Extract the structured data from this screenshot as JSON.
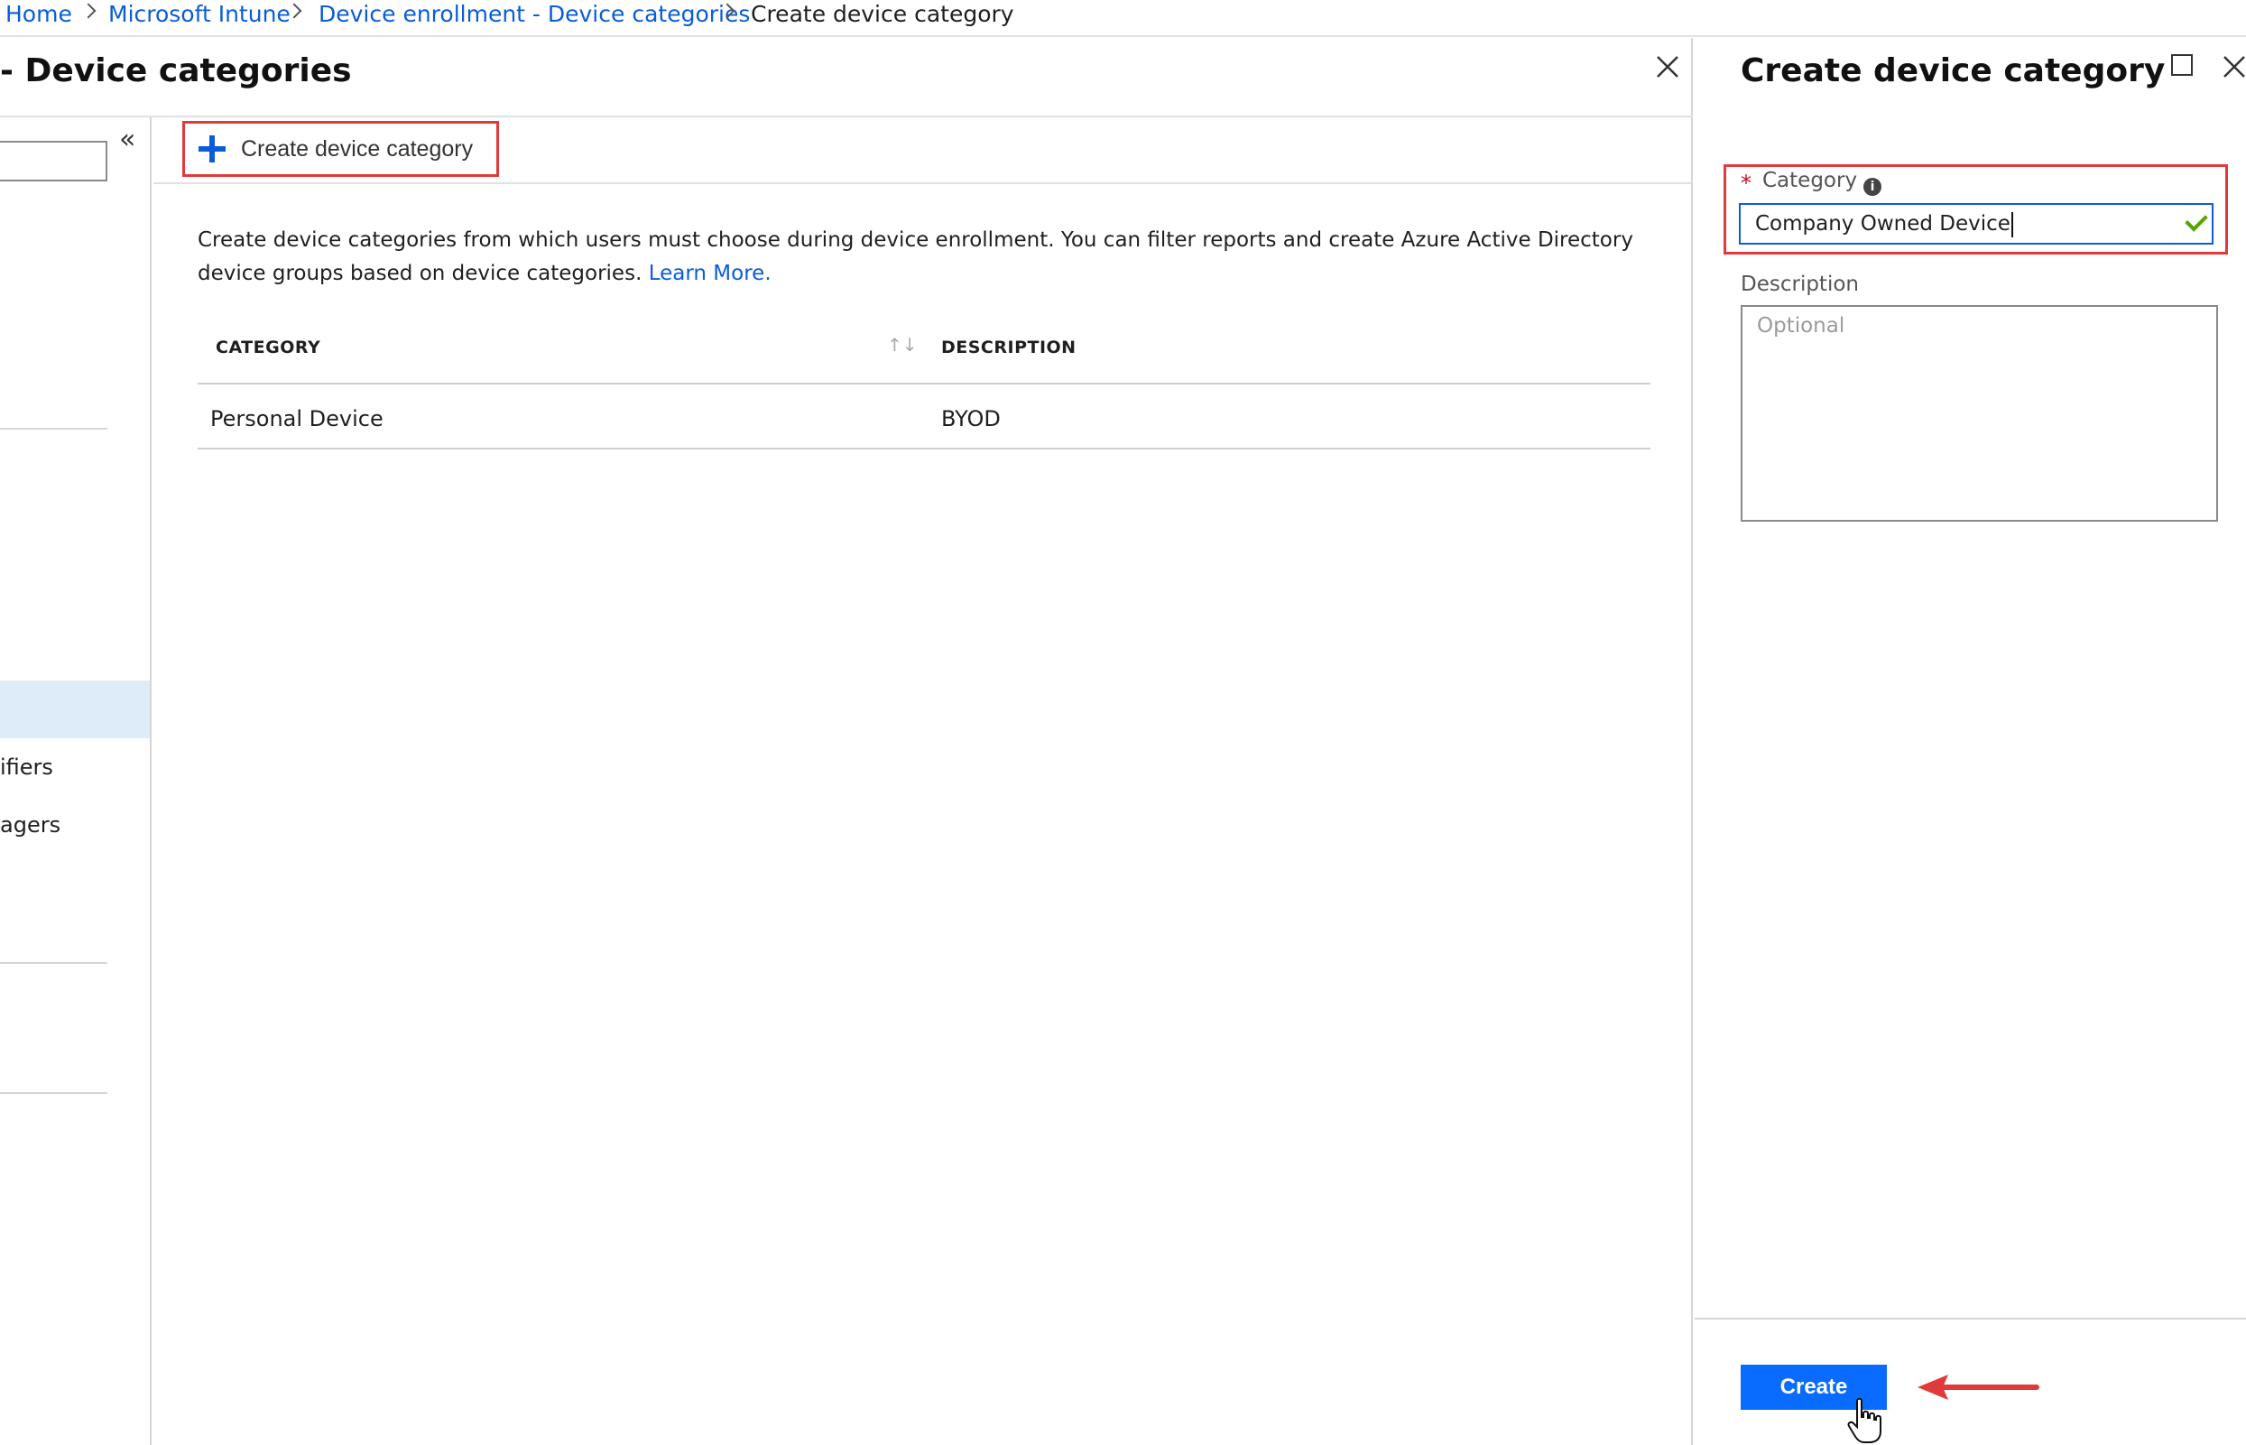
{
  "breadcrumb": {
    "items": [
      {
        "label": "Home"
      },
      {
        "label": "Microsoft Intune"
      },
      {
        "label": "Device enrollment - Device categories"
      },
      {
        "label": "Create device category"
      }
    ]
  },
  "left_blade": {
    "title": "- Device categories",
    "menu": {
      "partial_items": [
        "ifiers",
        "agers"
      ]
    },
    "toolbar": {
      "create_label": "Create device category"
    },
    "description": "Create device categories from which users must choose during device enrollment. You can filter reports and create Azure Active Directory device groups based on device categories.",
    "learn_more": "Learn More.",
    "table": {
      "headers": [
        "CATEGORY",
        "DESCRIPTION"
      ],
      "rows": [
        {
          "category": "Personal Device",
          "description": "BYOD"
        }
      ]
    }
  },
  "right_blade": {
    "title": "Create device category",
    "category": {
      "label": "Category",
      "required_mark": "*",
      "value": "Company Owned Device"
    },
    "description": {
      "label": "Description",
      "placeholder": "Optional"
    },
    "create_button": "Create"
  },
  "icons": {
    "chevron": "chevron-right-icon",
    "close": "close-icon",
    "maximize": "maximize-icon",
    "collapse": "double-chevron-left-icon",
    "plus": "plus-icon",
    "info": "info-icon",
    "check": "checkmark-icon",
    "sort": "sort-icon",
    "cursor": "hand-cursor-icon",
    "arrow": "red-arrow-icon"
  },
  "colors": {
    "link": "#0a5dd6",
    "primary_button": "#0a6cff",
    "highlight": "#e03a3a",
    "selected_menu": "#deecf9",
    "valid": "#57a300"
  }
}
